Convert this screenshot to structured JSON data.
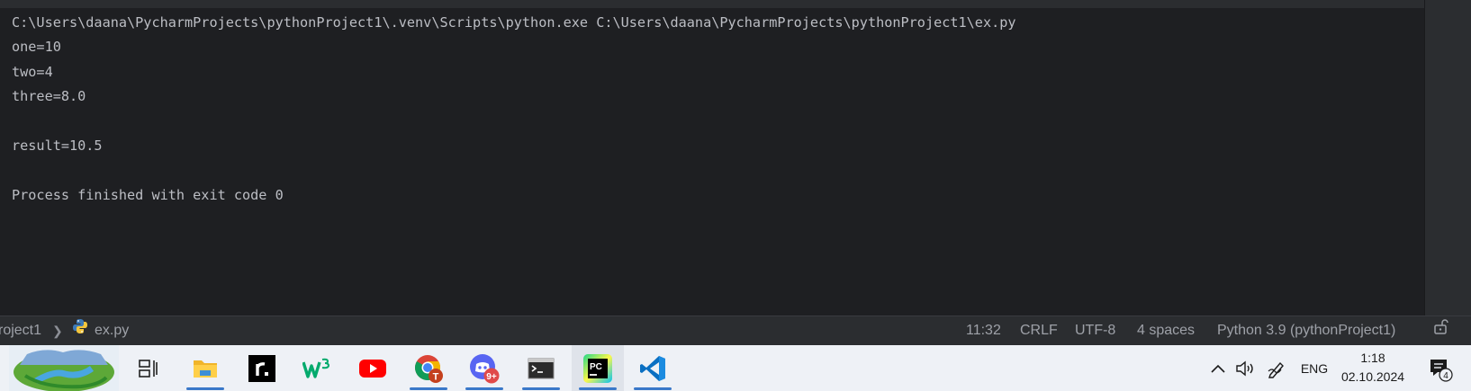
{
  "console": {
    "lines": [
      "C:\\Users\\daana\\PycharmProjects\\pythonProject1\\.venv\\Scripts\\python.exe C:\\Users\\daana\\PycharmProjects\\pythonProject1\\ex.py",
      "one=10",
      "two=4",
      "three=8.0",
      "",
      "result=10.5",
      "",
      "Process finished with exit code 0"
    ]
  },
  "statusbar": {
    "breadcrumb_project": "roject1",
    "breadcrumb_file": "ex.py",
    "caret_position": "11:32",
    "line_separator": "CRLF",
    "encoding": "UTF-8",
    "indent": "4 spaces",
    "interpreter": "Python 3.9 (pythonProject1)"
  },
  "taskbar": {
    "apps": [
      {
        "name": "desktop-thumbnail",
        "icon": "landscape-icon"
      },
      {
        "name": "task-view",
        "icon": "task-view-icon"
      },
      {
        "name": "file-explorer",
        "icon": "folder-icon"
      },
      {
        "name": "rider",
        "icon": "r-app-icon"
      },
      {
        "name": "w3schools",
        "icon": "w3-icon"
      },
      {
        "name": "youtube",
        "icon": "youtube-icon"
      },
      {
        "name": "chrome",
        "icon": "chrome-icon",
        "badge": "T"
      },
      {
        "name": "discord",
        "icon": "discord-icon",
        "badge": "9+"
      },
      {
        "name": "terminal",
        "icon": "terminal-icon"
      },
      {
        "name": "pycharm",
        "icon": "pycharm-icon"
      },
      {
        "name": "vscode",
        "icon": "vscode-icon"
      }
    ],
    "tray": {
      "language": "ENG",
      "time": "1:18",
      "date": "02.10.2024",
      "notification_count": "4"
    }
  },
  "colors": {
    "console_bg": "#1e1f22",
    "console_text": "#bcbec4",
    "statusbar_bg": "#2b2d30",
    "taskbar_bg": "#eef1f6",
    "taskbar_accent": "#3a78c9"
  }
}
